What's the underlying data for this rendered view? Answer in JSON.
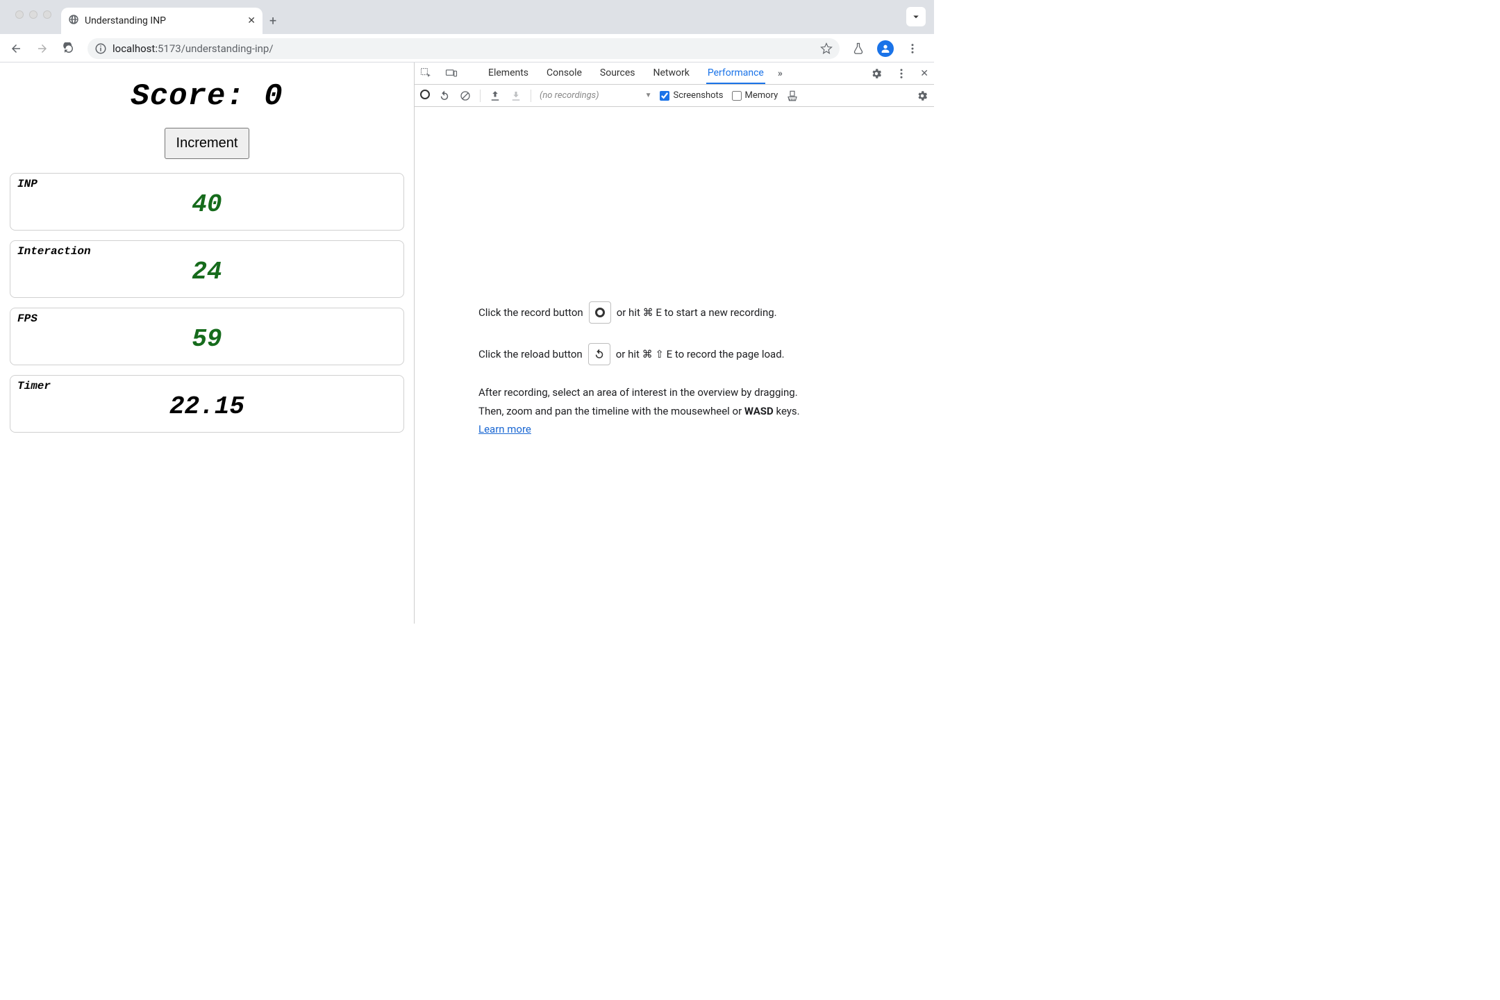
{
  "browser": {
    "tab_title": "Understanding INP",
    "url_host": "localhost:",
    "url_port_path": "5173/understanding-inp/"
  },
  "page": {
    "score_label": "Score: ",
    "score_value": "0",
    "increment_label": "Increment",
    "metrics": [
      {
        "label": "INP",
        "value": "40",
        "green": true
      },
      {
        "label": "Interaction",
        "value": "24",
        "green": true
      },
      {
        "label": "FPS",
        "value": "59",
        "green": true
      },
      {
        "label": "Timer",
        "value": "22.15",
        "green": false
      }
    ]
  },
  "devtools": {
    "tabs": [
      "Elements",
      "Console",
      "Sources",
      "Network",
      "Performance"
    ],
    "active_tab": "Performance",
    "recordings_placeholder": "(no recordings)",
    "screenshots_label": "Screenshots",
    "screenshots_checked": true,
    "memory_label": "Memory",
    "memory_checked": false,
    "body": {
      "line1_pre": "Click the record button",
      "line1_post": "or hit ⌘ E to start a new recording.",
      "line2_pre": "Click the reload button",
      "line2_post": "or hit ⌘ ⇧ E to record the page load.",
      "para1": "After recording, select an area of interest in the overview by dragging.",
      "para2_pre": "Then, zoom and pan the timeline with the mousewheel or ",
      "para2_bold": "WASD",
      "para2_post": " keys.",
      "learn_more": "Learn more"
    }
  }
}
